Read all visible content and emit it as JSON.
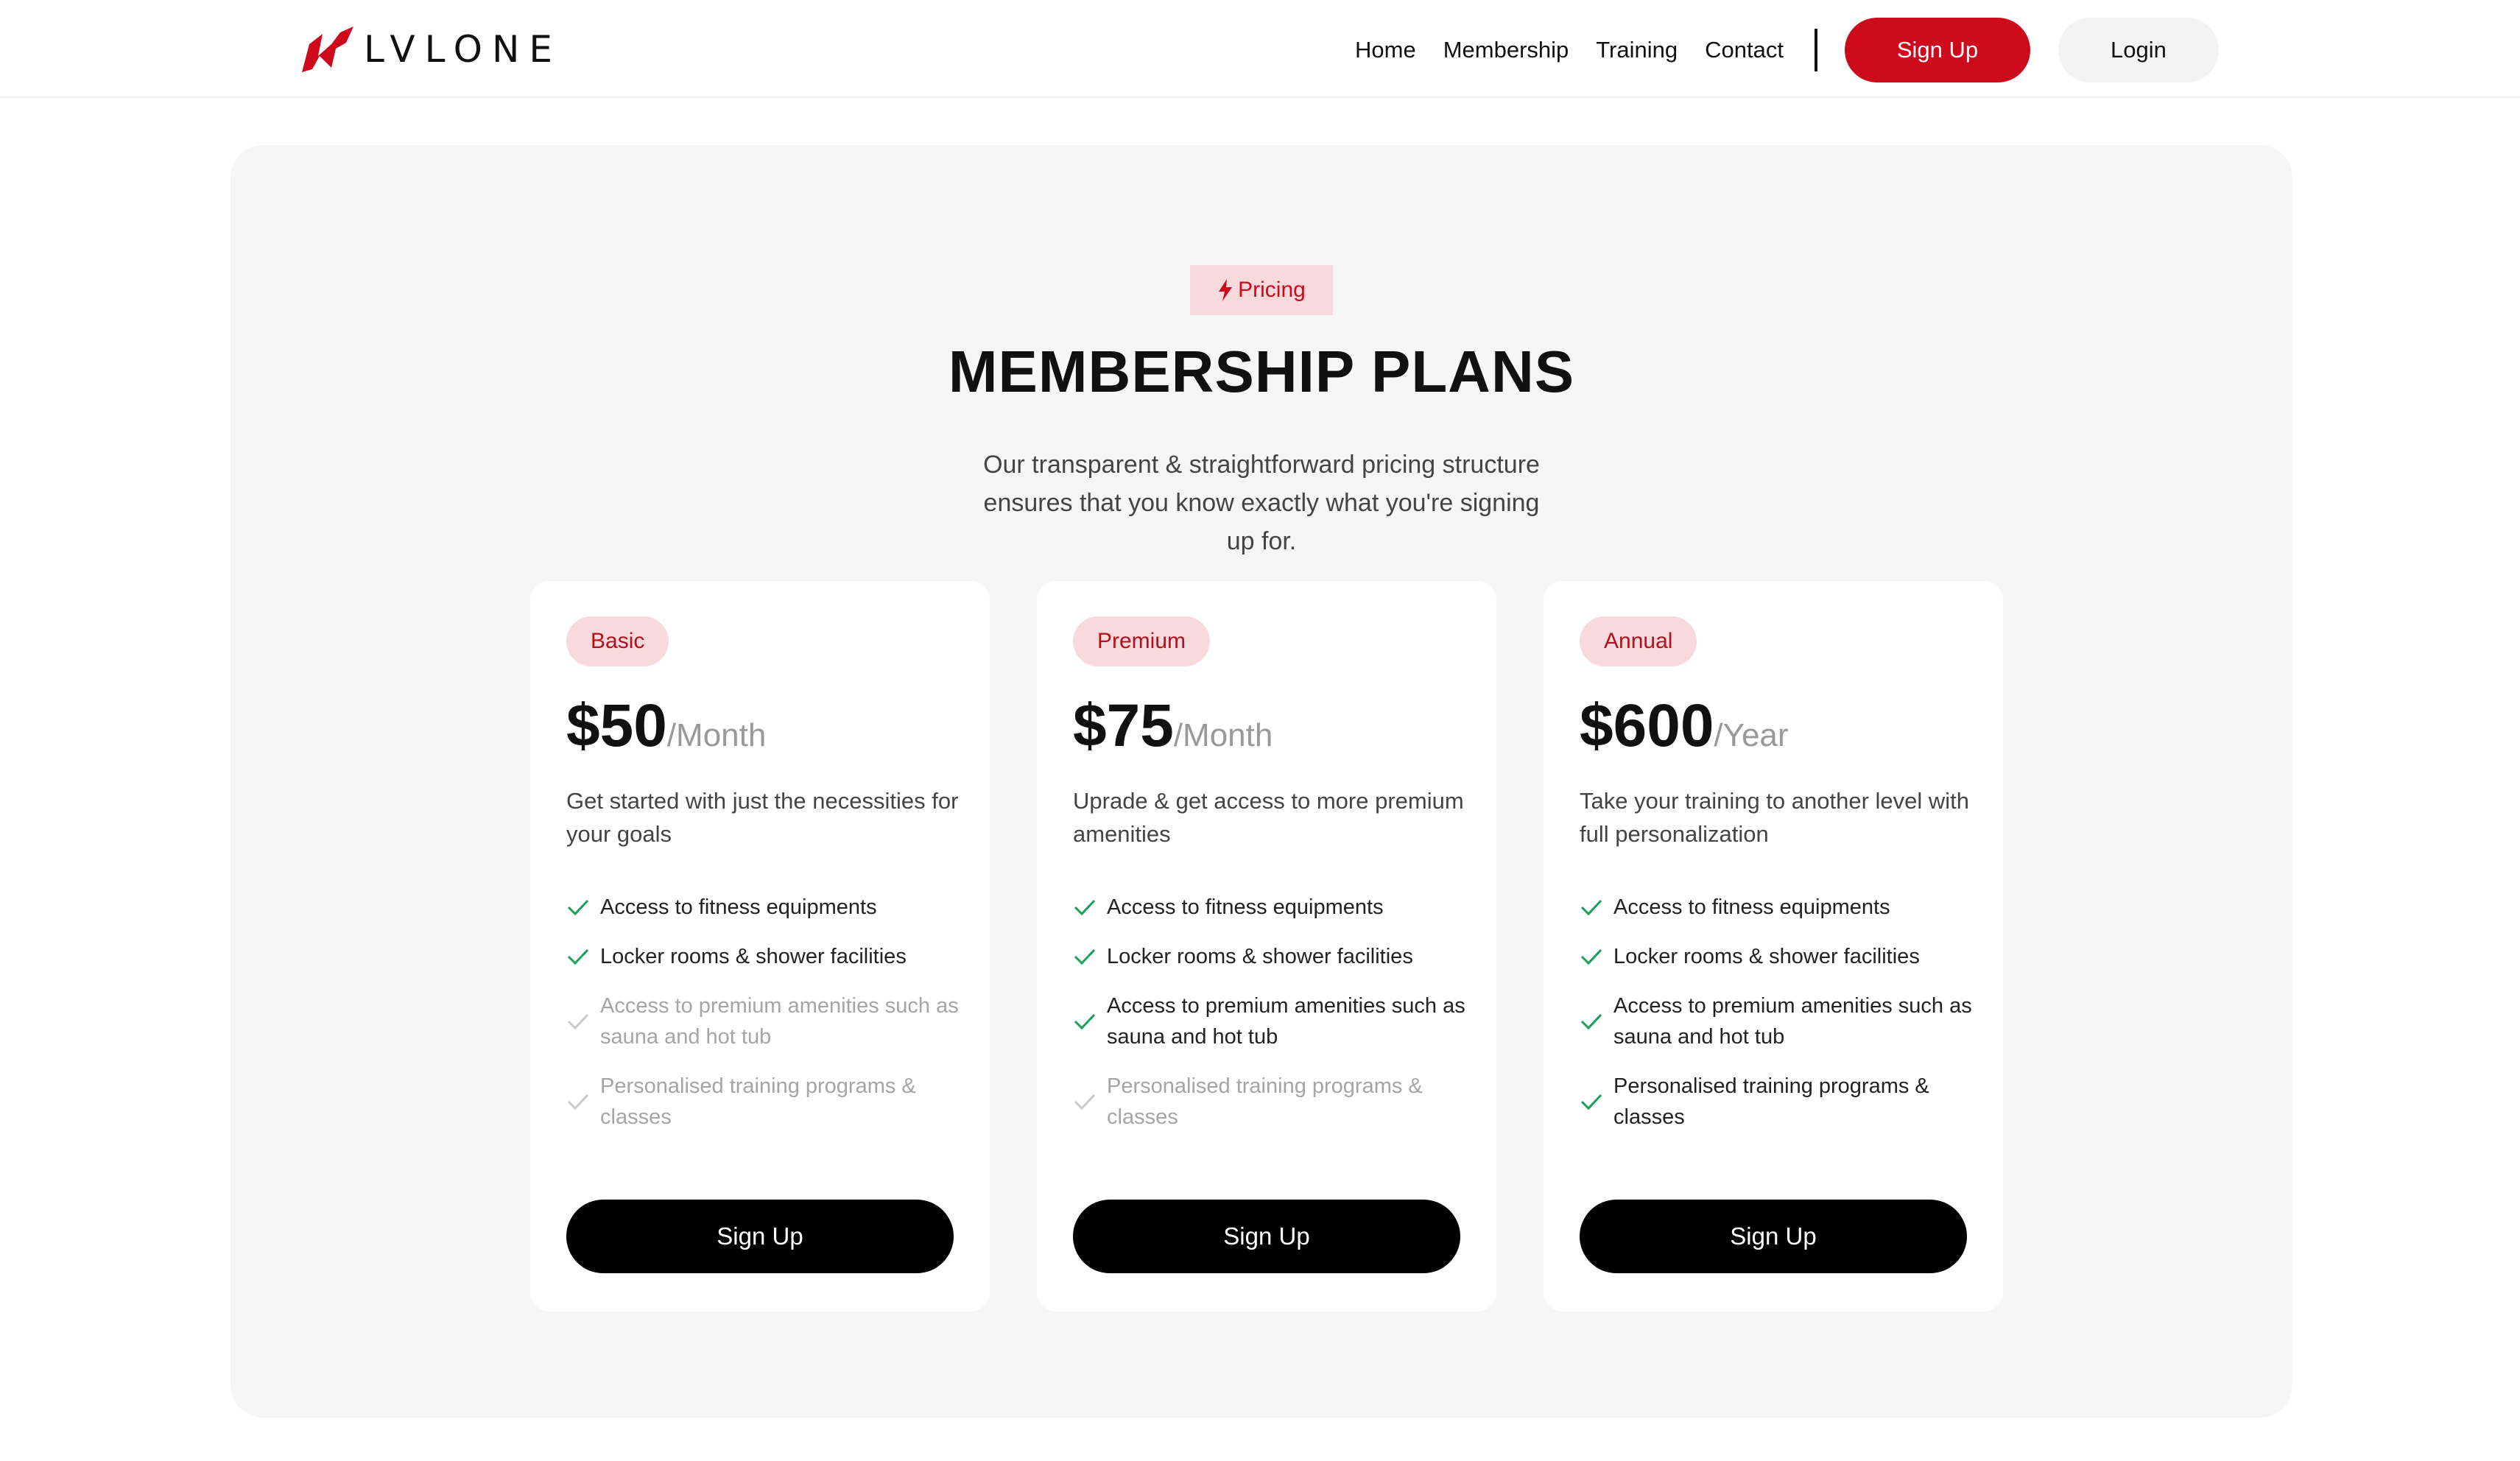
{
  "brand": {
    "name": "LVLONE",
    "accent": "#cc0a1b"
  },
  "nav": {
    "links": [
      "Home",
      "Membership",
      "Training",
      "Contact"
    ],
    "signup_label": "Sign Up",
    "login_label": "Login"
  },
  "pricing": {
    "badge": "Pricing",
    "title": "MEMBERSHIP PLANS",
    "subtitle": "Our transparent & straightforward pricing structure ensures that you know exactly what you're signing up for."
  },
  "plans": [
    {
      "name": "Basic",
      "price": "$50",
      "period": "/Month",
      "description": "Get started with just the necessities for your goals",
      "features": [
        {
          "text": "Access to fitness equipments",
          "included": true
        },
        {
          "text": "Locker rooms & shower facilities",
          "included": true
        },
        {
          "text": "Access to premium amenities such as sauna and hot tub",
          "included": false
        },
        {
          "text": "Personalised training programs & classes",
          "included": false
        }
      ],
      "button": "Sign Up"
    },
    {
      "name": "Premium",
      "price": "$75",
      "period": "/Month",
      "description": "Uprade & get access to more premium amenities",
      "features": [
        {
          "text": "Access to fitness equipments",
          "included": true
        },
        {
          "text": "Locker rooms & shower facilities",
          "included": true
        },
        {
          "text": "Access to premium amenities such as sauna and hot tub",
          "included": true
        },
        {
          "text": "Personalised training programs & classes",
          "included": false
        }
      ],
      "button": "Sign Up"
    },
    {
      "name": "Annual",
      "price": "$600",
      "period": "/Year",
      "description": "Take your training to another level with full personalization",
      "features": [
        {
          "text": "Access to fitness equipments",
          "included": true
        },
        {
          "text": "Locker rooms & shower facilities",
          "included": true
        },
        {
          "text": "Access to premium amenities such as sauna and hot tub",
          "included": true
        },
        {
          "text": "Personalised training programs & classes",
          "included": true
        }
      ],
      "button": "Sign Up"
    }
  ],
  "icons": {
    "logo": "lightning-logo-icon",
    "badge": "bolt-icon",
    "feature": "check-icon"
  },
  "colors": {
    "accent": "#cc0a1b",
    "badge_bg": "#f8d9dc",
    "check_included": "#19a05a",
    "check_excluded": "#c9c9c9",
    "section_bg": "#f6f6f6"
  }
}
